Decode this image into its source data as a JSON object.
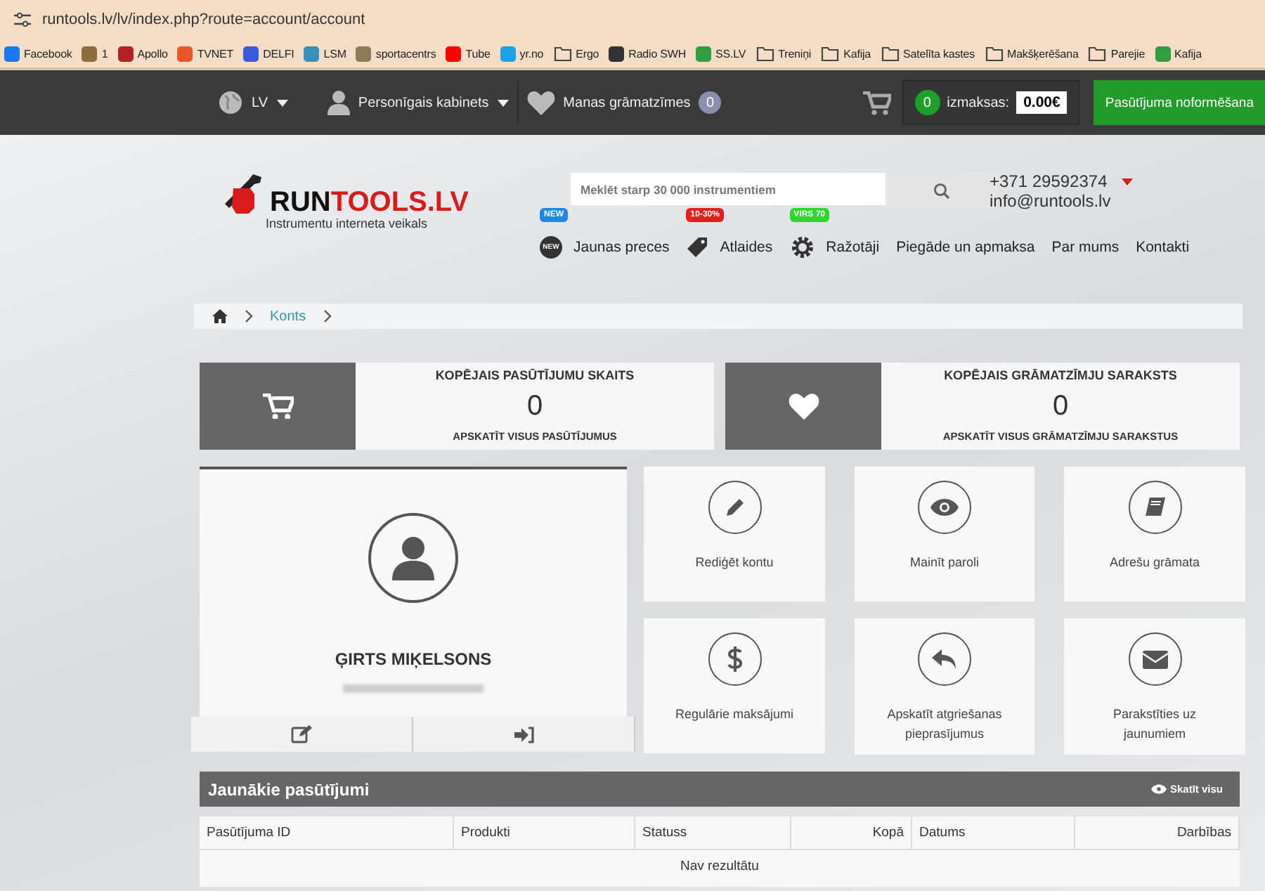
{
  "browser": {
    "url": "runtools.lv/lv/index.php?route=account/account",
    "bookmarks": [
      {
        "label": "Facebook",
        "kind": "site",
        "color": "#1877f2"
      },
      {
        "label": "1",
        "kind": "site",
        "color": "#8a6d3b"
      },
      {
        "label": "Apollo",
        "kind": "site",
        "color": "#b22222"
      },
      {
        "label": "TVNET",
        "kind": "site",
        "color": "#e8572a"
      },
      {
        "label": "DELFI",
        "kind": "site",
        "color": "#3b5bdb"
      },
      {
        "label": "LSM",
        "kind": "site",
        "color": "#3a8fb7"
      },
      {
        "label": "sportacentrs",
        "kind": "site",
        "color": "#8c7b5a"
      },
      {
        "label": "Tube",
        "kind": "site",
        "color": "#ff0000"
      },
      {
        "label": "yr.no",
        "kind": "site",
        "color": "#1aa3e8"
      },
      {
        "label": "Ergo",
        "kind": "folder"
      },
      {
        "label": "Radio SWH",
        "kind": "site",
        "color": "#333333"
      },
      {
        "label": "SS.LV",
        "kind": "site",
        "color": "#2e9e3e"
      },
      {
        "label": "Treniņi",
        "kind": "folder"
      },
      {
        "label": "Kafija",
        "kind": "folder"
      },
      {
        "label": "Satelīta kastes",
        "kind": "folder"
      },
      {
        "label": "Makšķerēšana",
        "kind": "folder"
      },
      {
        "label": "Parejie",
        "kind": "folder"
      },
      {
        "label": "Kafija",
        "kind": "site",
        "color": "#2e9e3e"
      }
    ]
  },
  "top_nav": {
    "language": "LV",
    "account": "Personīgais kabinets",
    "bookmarks": "Manas grāmatzīmes",
    "bookmarks_count": "0",
    "cart_count": "0",
    "total_label": "izmaksas:",
    "total": "0.00€",
    "checkout": "Pasūtījuma noformēšana"
  },
  "header": {
    "logo_part_1": "RUN",
    "logo_part_2": "TOOLS.LV",
    "tagline": "Instrumentu interneta veikals",
    "search": {
      "placeholder": "Meklēt starp 30 000 instrumentiem"
    },
    "phone": "+371 29592374",
    "email": "info@runtools.lv",
    "menu": [
      {
        "label": "Jaunas preces",
        "kind": "new",
        "badge": "NEW",
        "color": "#1e88e5",
        "icon_label": "NEW"
      },
      {
        "label": "Atlaides",
        "kind": "tag",
        "badge": "10-30%",
        "color": "#e0201c"
      },
      {
        "label": "Ražotāji",
        "kind": "gear",
        "badge": "VIRS 70",
        "color": "#2ed62e"
      },
      {
        "label": "Piegāde un apmaksa",
        "kind": "plain"
      },
      {
        "label": "Par mums",
        "kind": "plain"
      },
      {
        "label": "Kontakti",
        "kind": "plain"
      }
    ]
  },
  "breadcrumb": [
    "Konts"
  ],
  "stats": [
    {
      "kind": "cart",
      "title": "KOPĒJAIS PASŪTĪJUMU SKAITS",
      "value": "0",
      "link": "APSKATĪT VISUS PASŪTĪJUMUS"
    },
    {
      "kind": "heart",
      "title": "KOPĒJAIS GRĀMATZĪMJU SARAKSTS",
      "value": "0",
      "link": "APSKATĪT VISUS GRĀMATZĪMJU SARAKSTUS"
    }
  ],
  "profile": {
    "name": "ĢIRTS MIĶELSONS"
  },
  "tiles": [
    {
      "kind": "pencil",
      "label": "Rediģēt kontu"
    },
    {
      "kind": "eye",
      "label": "Mainīt paroli"
    },
    {
      "kind": "book",
      "label": "Adrešu grāmata"
    },
    {
      "kind": "dollar",
      "label": "Regulārie maksājumi"
    },
    {
      "kind": "reply",
      "label": "Apskatīt atgriešanas pieprasījumus"
    },
    {
      "kind": "envelope",
      "label": "Parakstīties uz jaunumiem"
    }
  ],
  "orders": {
    "title": "Jaunākie pasūtījumi",
    "view_all": "Skatīt visu",
    "columns": [
      "Pasūtījuma ID",
      "Produkti",
      "Statuss",
      "Kopā",
      "Datums",
      "Darbības"
    ],
    "empty": "Nav rezultātu"
  }
}
